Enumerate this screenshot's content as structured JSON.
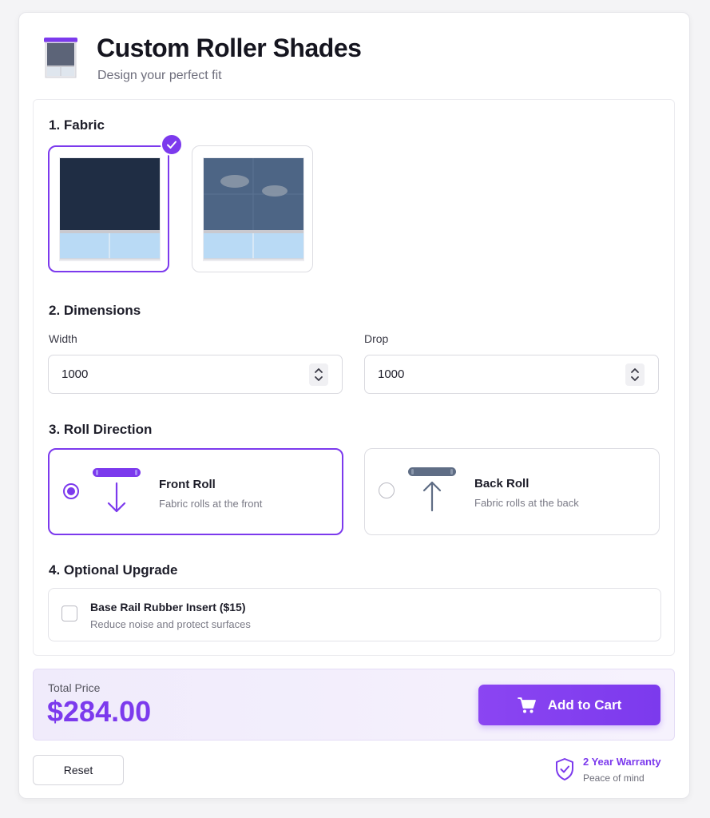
{
  "header": {
    "title": "Custom Roller Shades",
    "subtitle": "Design your perfect fit",
    "logo_icon": "roller-shade-icon"
  },
  "fabric": {
    "section_title": "1. Fabric",
    "options": [
      {
        "name": "dark-blackout",
        "selected": true,
        "color": "#1f2d44"
      },
      {
        "name": "light-filtering",
        "selected": false,
        "color": "#4d6585"
      }
    ]
  },
  "dimensions": {
    "section_title": "2. Dimensions",
    "width_label": "Width",
    "width_value": "1000",
    "drop_label": "Drop",
    "drop_value": "1000"
  },
  "roll_direction": {
    "section_title": "3. Roll Direction",
    "options": [
      {
        "name": "Front Roll",
        "description": "Fabric rolls at the front",
        "selected": true
      },
      {
        "name": "Back Roll",
        "description": "Fabric rolls at the back",
        "selected": false
      }
    ]
  },
  "upgrade": {
    "section_title": "4. Optional Upgrade",
    "name": "Base Rail Rubber Insert ($15)",
    "description": "Reduce noise and protect surfaces",
    "checked": false
  },
  "price": {
    "label": "Total Price",
    "value": "$284.00"
  },
  "actions": {
    "add_to_cart": "Add to Cart",
    "reset": "Reset"
  },
  "warranty": {
    "title": "2 Year Warranty",
    "subtitle": "Peace of mind"
  },
  "colors": {
    "accent": "#7c3aed",
    "text": "#1d1d29",
    "muted": "#7a7a86"
  }
}
